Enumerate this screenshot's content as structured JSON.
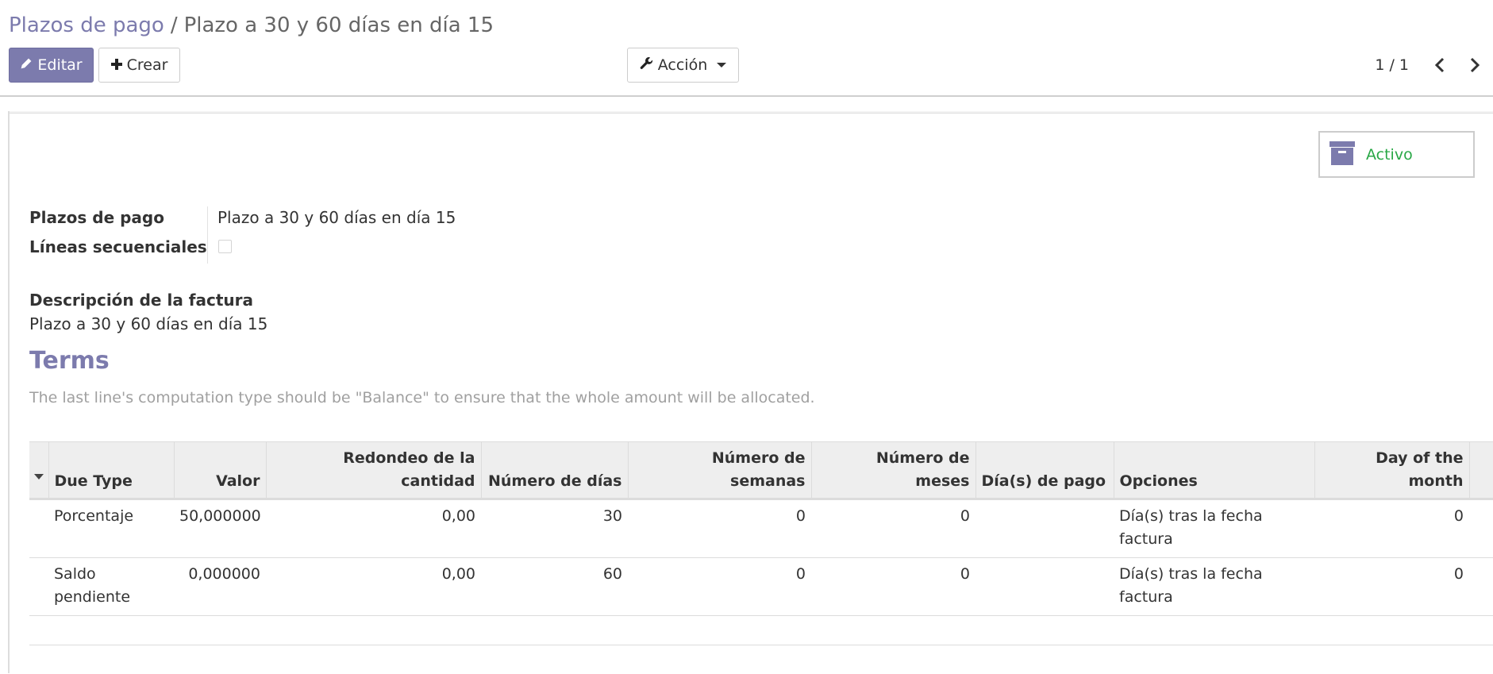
{
  "breadcrumb": {
    "parent": "Plazos de pago",
    "separator": "/",
    "current": "Plazo a 30 y 60 días en día 15"
  },
  "toolbar": {
    "edit_label": "Editar",
    "create_label": "Crear",
    "action_label": "Acción"
  },
  "pager": {
    "value": "1 / 1"
  },
  "active_button": {
    "label": "Activo",
    "icon": "archive-icon",
    "label_color": "#28a745"
  },
  "form": {
    "payment_term_label": "Plazos de pago",
    "payment_term_value": "Plazo a 30 y 60 días en día 15",
    "sequential_lines_label": "Líneas secuenciales",
    "sequential_lines_checked": false,
    "invoice_description_label": "Descripción de la factura",
    "invoice_description_value": "Plazo a 30 y 60 días en día 15"
  },
  "terms": {
    "title": "Terms",
    "help": "The last line's computation type should be \"Balance\" to ensure that the whole amount will be allocated.",
    "columns": [
      "Due Type",
      "Valor",
      "Redondeo de la cantidad",
      "Número de días",
      "Número de semanas",
      "Número de meses",
      "Día(s) de pago",
      "Opciones",
      "Day of the month"
    ],
    "rows": [
      [
        "Porcentaje",
        "50,000000",
        "0,00",
        "30",
        "0",
        "0",
        "",
        "Día(s) tras la fecha factura",
        "0"
      ],
      [
        "Saldo pendiente",
        "0,000000",
        "0,00",
        "60",
        "0",
        "0",
        "",
        "Día(s) tras la fecha factura",
        "0"
      ]
    ]
  },
  "colors": {
    "brand": "#7c7bad",
    "active": "#28a745"
  }
}
